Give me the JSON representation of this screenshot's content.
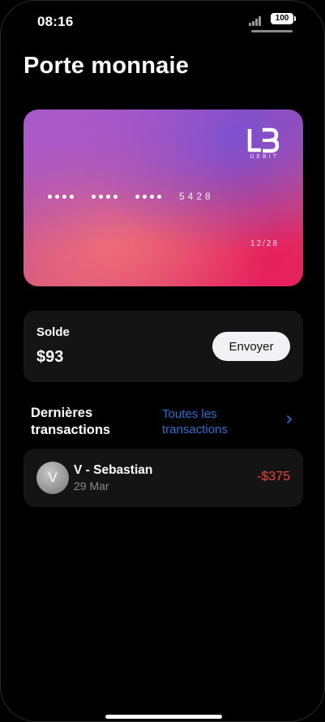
{
  "status_bar": {
    "time": "08:16",
    "battery": "100"
  },
  "page": {
    "title": "Porte monnaie"
  },
  "card": {
    "logo_text": "DEBIT",
    "last_digits": "5428",
    "expiry": "12/28"
  },
  "balance": {
    "label": "Solde",
    "amount": "$93",
    "send_label": "Envoyer"
  },
  "transactions": {
    "title": "Dernières transactions",
    "see_all": "Toutes les transactions",
    "items": [
      {
        "initial": "V",
        "name": "V - Sebastian",
        "date": "29 Mar",
        "amount": "-$375"
      }
    ]
  },
  "colors": {
    "background": "#000000",
    "surface": "#141414",
    "link": "#2f6fd6",
    "negative": "#e8473b"
  },
  "icons": {
    "signal": "cellular-signal-icon",
    "battery": "battery-icon",
    "chevron": "chevron-right-icon",
    "logo": "lb-logo-icon"
  }
}
